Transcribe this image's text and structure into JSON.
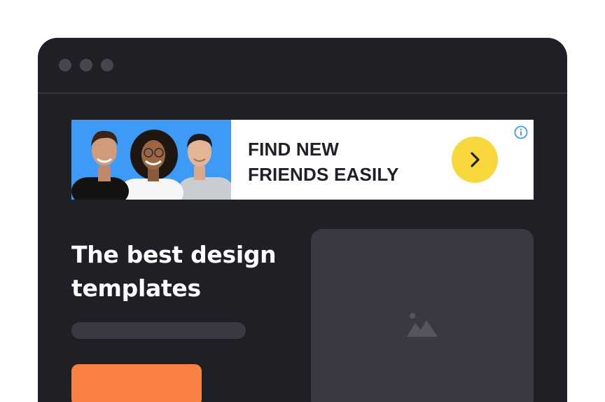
{
  "browser": {
    "window_dots": [
      "dot-1",
      "dot-2",
      "dot-3"
    ]
  },
  "ad": {
    "headline_line1": "FIND NEW",
    "headline_line2": "FRIENDS EASILY",
    "cta_icon": "chevron-right-icon",
    "info_icon": "info-icon",
    "photo_background": "#3d9af7",
    "cta_color": "#f7d73c"
  },
  "hero": {
    "title_line1": "The best design",
    "title_line2": "templates",
    "button_color": "#fa8144",
    "image_icon": "image-icon"
  },
  "colors": {
    "window_bg": "#1f1f26",
    "placeholder": "#393941",
    "accent": "#fa8144"
  }
}
